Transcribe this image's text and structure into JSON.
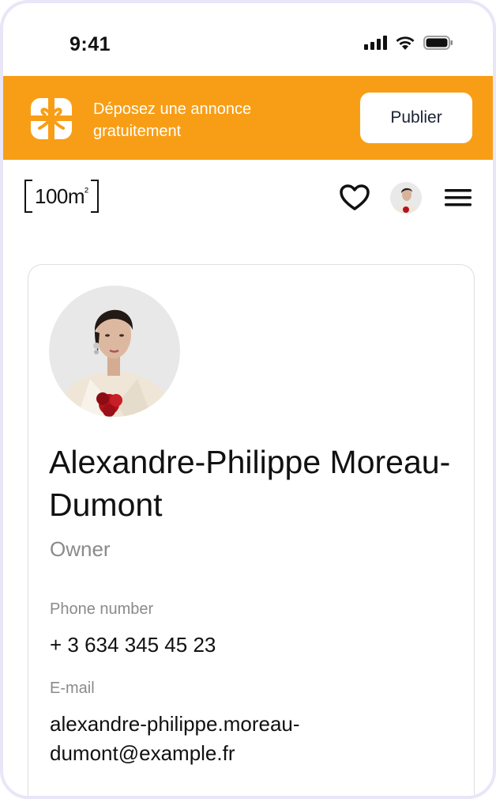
{
  "status_bar": {
    "time": "9:41",
    "icons": [
      "cellular-signal-icon",
      "wifi-icon",
      "battery-icon"
    ]
  },
  "promo": {
    "icon": "gift-icon",
    "text": "Déposez une annonce gratuitement",
    "button_label": "Publier",
    "background_color": "#f89e16"
  },
  "header": {
    "logo_text": "100m",
    "logo_sup": "²",
    "icons": [
      "heart-icon",
      "avatar",
      "menu-icon"
    ]
  },
  "profile": {
    "name": "Alexandre-Philippe Moreau-Dumont",
    "role": "Owner",
    "phone_label": "Phone number",
    "phone_value": "+ 3 634 345 45 23",
    "email_label": "E-mail",
    "email_value": "alexandre-philippe.moreau-dumont@example.fr"
  },
  "colors": {
    "accent": "#f89e16",
    "text": "#111111",
    "muted": "#8a8a8a",
    "frame": "#e8e6f7"
  }
}
